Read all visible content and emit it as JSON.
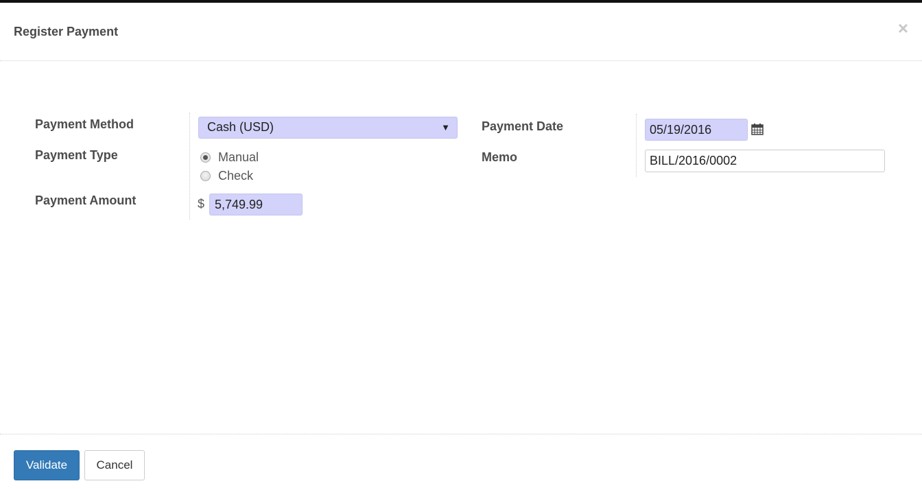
{
  "dialog": {
    "title": "Register Payment",
    "close_icon": "×"
  },
  "form": {
    "payment_method": {
      "label": "Payment Method",
      "value": "Cash (USD)",
      "caret": "▼"
    },
    "payment_type": {
      "label": "Payment Type",
      "options": [
        {
          "label": "Manual",
          "checked": true
        },
        {
          "label": "Check",
          "checked": false
        }
      ]
    },
    "payment_amount": {
      "label": "Payment Amount",
      "currency_symbol": "$",
      "value": "5,749.99"
    },
    "payment_date": {
      "label": "Payment Date",
      "value": "05/19/2016",
      "icon": "calendar-icon"
    },
    "memo": {
      "label": "Memo",
      "value": "BILL/2016/0002"
    }
  },
  "footer": {
    "validate_label": "Validate",
    "cancel_label": "Cancel"
  },
  "colors": {
    "primary": "#337ab7",
    "required_field_bg": "#d2d2fb"
  }
}
